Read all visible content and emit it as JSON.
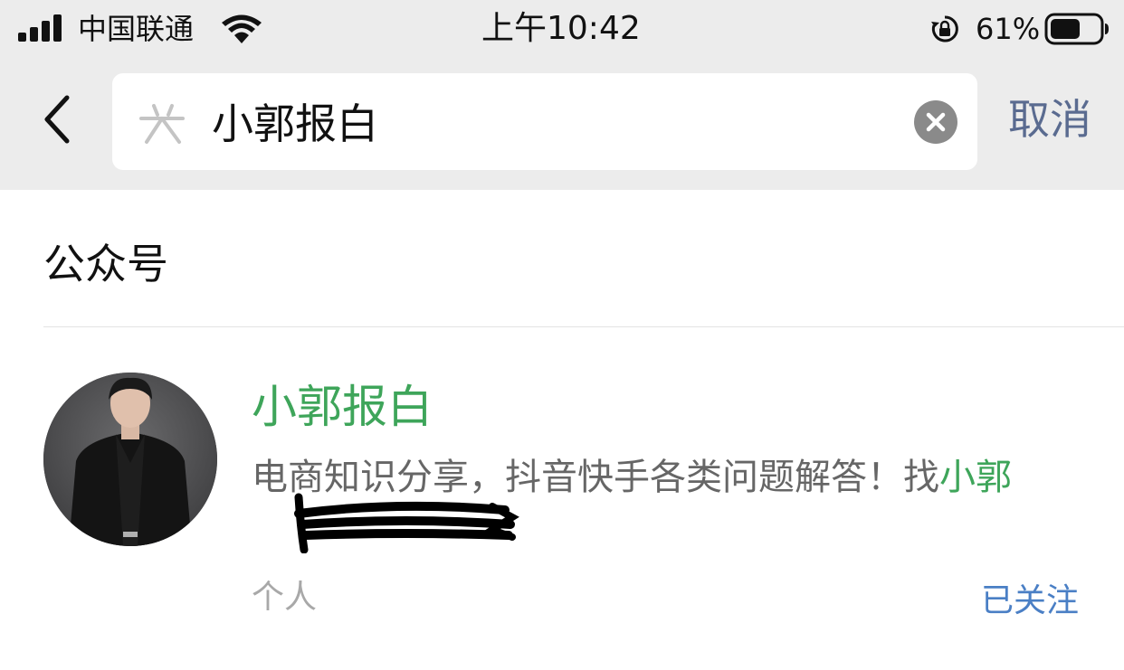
{
  "status_bar": {
    "carrier": "中国联通",
    "time": "上午10:42",
    "battery_percent": "61%",
    "battery_level": 0.61,
    "icons": [
      "signal-icon",
      "wifi-icon",
      "rotation-lock-icon",
      "battery-icon"
    ]
  },
  "search": {
    "query": "小郭报白",
    "cancel_label": "取消",
    "icons": [
      "back-chevron-icon",
      "search-logo-icon",
      "clear-icon"
    ]
  },
  "section": {
    "title": "公众号"
  },
  "result": {
    "name": "小郭报白",
    "description_prefix": "电商知识分享，抖音快手各类问题解答！找",
    "description_highlight": "小郭",
    "type": "个人",
    "follow_status": "已关注"
  },
  "colors": {
    "highlight_green": "#3ea55a",
    "link_blue": "#4a7fc5",
    "cancel_blue": "#5a6b90",
    "header_bg": "#ececec"
  }
}
